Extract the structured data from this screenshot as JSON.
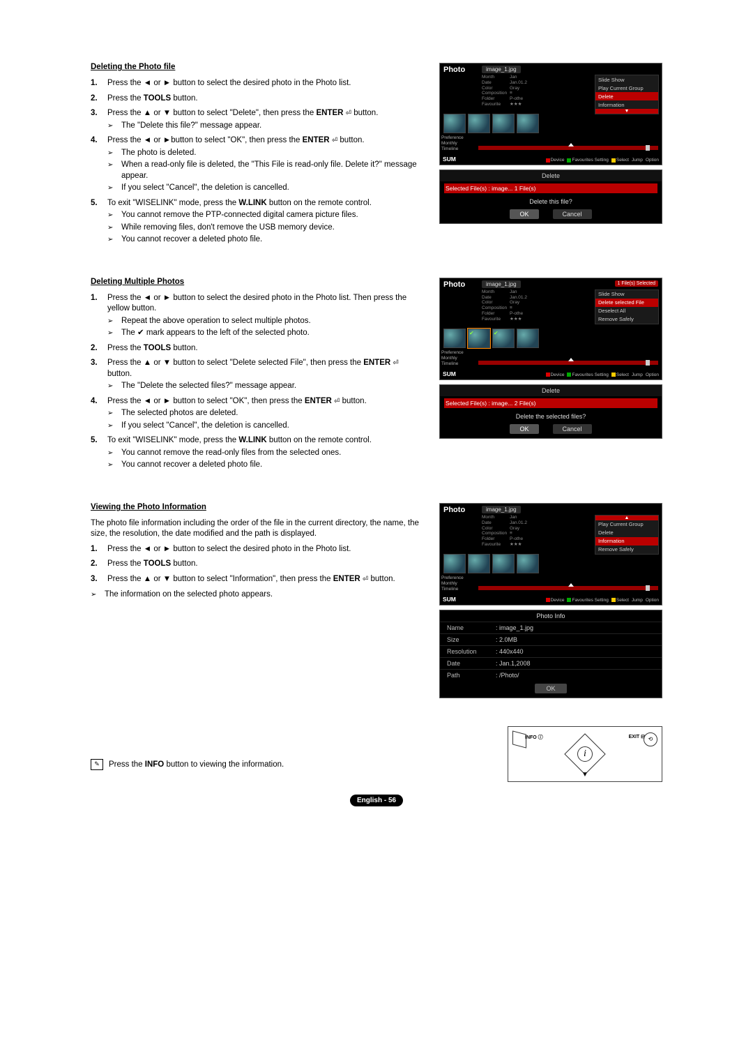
{
  "footer": {
    "page_label": "English - 56"
  },
  "info_note": {
    "text_prefix": "Press the ",
    "info_btn": "INFO",
    "text_suffix": " button to viewing the information."
  },
  "remote": {
    "info_label": "INFO",
    "exit_label": "EXIT",
    "i": "i",
    "down": "▼",
    "exit_icon": "⟲"
  },
  "tv": {
    "title": "Photo",
    "filename": "image_1.jpg",
    "badge": "1 File(s) Selected",
    "meta": {
      "month_l": "Month",
      "month_v": "Jan",
      "date_l": "Date",
      "date_v": "Jan.01.2",
      "color_l": "Color",
      "color_v": "Gray",
      "comp_l": "Composition",
      "comp_v": "≡",
      "folder_l": "Folder",
      "folder_v": "P-othe",
      "fav_l": "Favourite",
      "fav_v": "★★★"
    },
    "menus": {
      "s1": [
        "Slide Show",
        "Play Current Group",
        "Delete",
        "Information"
      ],
      "s2": [
        "Slide Show",
        "Delete selected File",
        "Deselect All",
        "Remove Safely"
      ],
      "s3": [
        "Play Current Group",
        "Delete",
        "Information",
        "Remove Safely"
      ]
    },
    "sidebar": {
      "pref": "Preference",
      "monthly": "Monthly",
      "timeline": "Timeline"
    },
    "sum": "SUM",
    "legend": {
      "device": "Device",
      "fav": "Favourites Setting",
      "select": "Select",
      "jump": "Jump",
      "option": "Option"
    }
  },
  "dialog1": {
    "title": "Delete",
    "sel": "Selected File(s) : image...  1 File(s)",
    "msg": "Delete this file?",
    "ok": "OK",
    "cancel": "Cancel"
  },
  "dialog2": {
    "title": "Delete",
    "sel": "Selected File(s) : image...  2 File(s)",
    "msg": "Delete the selected files?",
    "ok": "OK",
    "cancel": "Cancel"
  },
  "infobox": {
    "title": "Photo Info",
    "rows": {
      "name_l": "Name",
      "name_v": ": image_1.jpg",
      "size_l": "Size",
      "size_v": ": 2.0MB",
      "res_l": "Resolution",
      "res_v": ": 440x440",
      "date_l": "Date",
      "date_v": ": Jan.1,2008",
      "path_l": "Path",
      "path_v": ": /Photo/"
    },
    "ok": "OK"
  },
  "s1": {
    "title": "Deleting the Photo file",
    "step1": {
      "a": "Press the ",
      "b": " or ",
      "c": " button to select the desired photo in the Photo list."
    },
    "step2": {
      "a": "Press the ",
      "tools": "TOOLS",
      "b": " button."
    },
    "step3": {
      "a": "Press the ",
      "b": " or ",
      "c": " button to select \"Delete\", then press the ",
      "enter": "ENTER",
      "d": " button.",
      "sub1": "The \"Delete this file?\" message appear."
    },
    "step4": {
      "a": "Press the ",
      "b": " or ",
      "c": "button to select \"OK\", then press the ",
      "enter": "ENTER",
      "d": " button.",
      "sub1": "The photo is deleted.",
      "sub2": "When a read-only file is deleted, the \"This File is read-only file. Delete it?\" message appear.",
      "sub3": "If you select \"Cancel\", the deletion is cancelled."
    },
    "step5": {
      "a": "To exit \"WISELINK\" mode, press the ",
      "wlink": "W.LINK",
      "b": " button on the remote control.",
      "sub1": "You cannot remove the PTP-connected digital camera picture files.",
      "sub2": "While removing files, don't remove the USB memory device.",
      "sub3": "You cannot recover a deleted photo file."
    }
  },
  "s2": {
    "title": "Deleting Multiple Photos",
    "step1": {
      "a": "Press the ",
      "b": " or ",
      "c": " button to select the desired photo in the Photo list. Then press the yellow button.",
      "sub1": "Repeat the above operation to select multiple photos.",
      "sub2a": "The ",
      "sub2b": " mark appears to the left of the selected photo."
    },
    "step2": {
      "a": "Press the ",
      "tools": "TOOLS",
      "b": " button."
    },
    "step3": {
      "a": "Press the ",
      "b": " or ",
      "c": " button to select \"Delete selected File\", then press the ",
      "enter": "ENTER",
      "d": " button.",
      "sub1": "The \"Delete the selected files?\" message appear."
    },
    "step4": {
      "a": "Press the ",
      "b": " or ",
      "c": " button to select \"OK\", then press the ",
      "enter": "ENTER",
      "d": " button.",
      "sub1": "The selected photos are deleted.",
      "sub2": "If you select \"Cancel\", the deletion is cancelled."
    },
    "step5": {
      "a": "To exit \"WISELINK\" mode, press the ",
      "wlink": "W.LINK",
      "b": " button on the remote control.",
      "sub1": "You cannot remove the read-only files from the selected ones.",
      "sub2": "You cannot recover a deleted photo file."
    }
  },
  "s3": {
    "title": "Viewing the Photo Information",
    "intro": "The photo file information including the order of the file in the current directory, the name, the size, the resolution, the date modified and the path is displayed.",
    "step1": {
      "a": "Press the ",
      "b": " or ",
      "c": " button to select the desired photo in the Photo list."
    },
    "step2": {
      "a": "Press the ",
      "tools": "TOOLS",
      "b": " button."
    },
    "step3": {
      "a": "Press the ",
      "b": " or ",
      "c": " button to select \"Information\", then press the ",
      "enter": "ENTER",
      "d": " button."
    },
    "sub1": "The information on the selected photo appears."
  }
}
